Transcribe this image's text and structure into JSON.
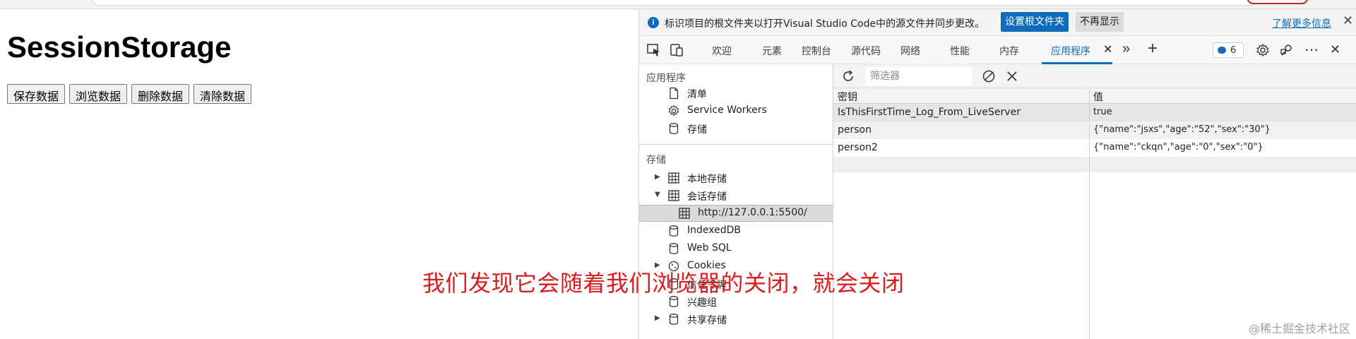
{
  "page": {
    "heading": "SessionStorage",
    "buttons": [
      "保存数据",
      "浏览数据",
      "删除数据",
      "清除数据"
    ]
  },
  "devtools": {
    "infobar": {
      "text": "标识项目的根文件夹以打开Visual Studio Code中的源文件并同步更改。",
      "primary_button": "设置根文件夹",
      "secondary_button": "不再显示",
      "link": "了解更多信息"
    },
    "tabs": {
      "welcome": "欢迎",
      "elements": "元素",
      "console": "控制台",
      "sources": "源代码",
      "network": "网络",
      "performance": "性能",
      "memory": "内存",
      "application": "应用程序"
    },
    "issues_count": "6",
    "sidebar": {
      "app_section": "应用程序",
      "manifest": "清单",
      "service_workers": "Service Workers",
      "storage": "存储",
      "storage_section": "存储",
      "local_storage": "本地存储",
      "session_storage": "会话存储",
      "session_origin": "http://127.0.0.1:5500/",
      "indexeddb": "IndexedDB",
      "websql": "Web SQL",
      "cookies": "Cookies",
      "trust_tokens": "信任令牌",
      "interest_groups": "兴趣组",
      "shared_storage": "共享存储"
    },
    "toolbar": {
      "filter_placeholder": "筛选器"
    },
    "table": {
      "col_key": "密钥",
      "col_value": "值",
      "rows": [
        {
          "key": "IsThisFirstTime_Log_From_LiveServer",
          "value": "true"
        },
        {
          "key": "person",
          "value": "{\"name\":\"jsxs\",\"age\":\"52\",\"sex\":\"30\"}"
        },
        {
          "key": "person2",
          "value": "{\"name\":\"ckqn\",\"age\":\"0\",\"sex\":\"0\"}"
        }
      ]
    }
  },
  "overlay": {
    "caption": "我们发现它会随着我们浏览器的关闭，就会关闭",
    "watermark": "@稀土掘金技术社区"
  },
  "colors": {
    "accent": "#0f6cbd",
    "caption": "#d81e1e"
  }
}
